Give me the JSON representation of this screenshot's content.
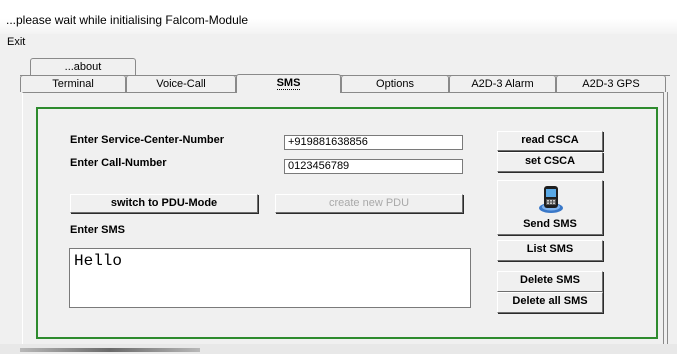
{
  "window": {
    "title": "...please wait while initialising Falcom-Module"
  },
  "menu": {
    "exit": "Exit"
  },
  "tabs": {
    "top_row": [
      {
        "label": "...about"
      }
    ],
    "bottom_row": [
      {
        "label": "Terminal"
      },
      {
        "label": "Voice-Call"
      },
      {
        "label": "SMS",
        "active": true
      },
      {
        "label": "Options"
      },
      {
        "label": "A2D-3 Alarm"
      },
      {
        "label": "A2D-3 GPS"
      }
    ]
  },
  "sms": {
    "service_center_label": "Enter Service-Center-Number",
    "service_center_value": "+919881638856",
    "call_number_label": "Enter Call-Number",
    "call_number_value": "0123456789",
    "switch_pdu": "switch to PDU-Mode",
    "create_pdu": "create new PDU",
    "enter_sms_label": "Enter SMS",
    "sms_text": "Hello",
    "read_csca": "read CSCA",
    "set_csca": "set CSCA",
    "send_sms": "Send SMS",
    "list_sms": "List SMS",
    "delete_sms": "Delete SMS",
    "delete_all_sms": "Delete all SMS"
  },
  "colors": {
    "group_border": "#2e8b2e",
    "window_bg": "#f0f0f0"
  }
}
